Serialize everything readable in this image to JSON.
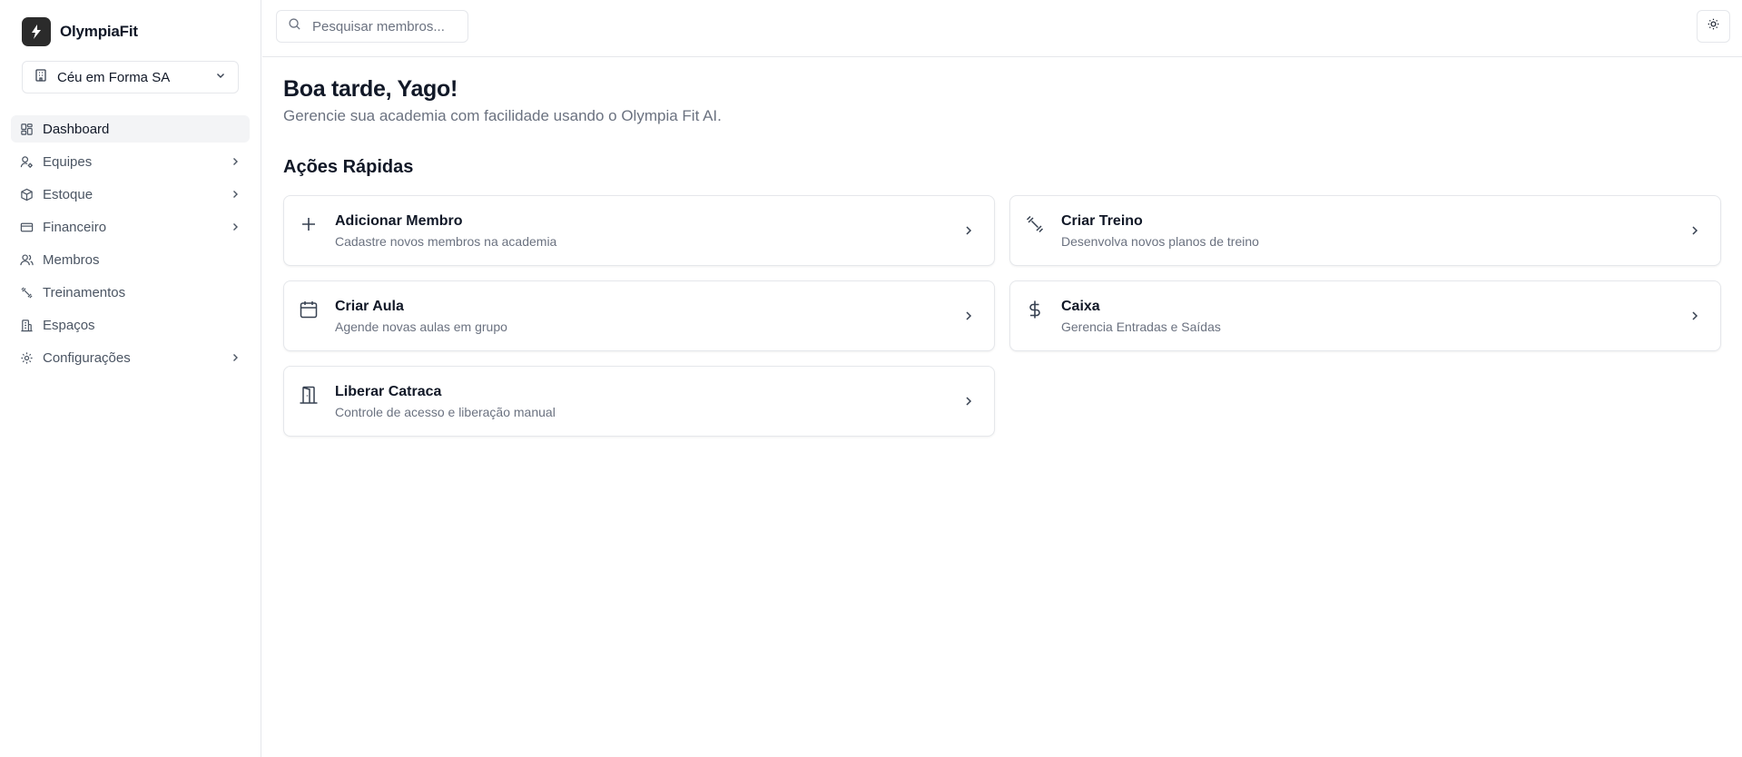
{
  "brand": {
    "name": "OlympiaFit"
  },
  "org_selector": {
    "value": "Céu em Forma SA"
  },
  "sidebar": {
    "items": [
      {
        "label": "Dashboard",
        "icon": "layout-grid-icon",
        "active": true,
        "expandable": false
      },
      {
        "label": "Equipes",
        "icon": "user-cog-icon",
        "active": false,
        "expandable": true
      },
      {
        "label": "Estoque",
        "icon": "package-icon",
        "active": false,
        "expandable": true
      },
      {
        "label": "Financeiro",
        "icon": "credit-card-icon",
        "active": false,
        "expandable": true
      },
      {
        "label": "Membros",
        "icon": "users-icon",
        "active": false,
        "expandable": false
      },
      {
        "label": "Treinamentos",
        "icon": "dumbbell-icon",
        "active": false,
        "expandable": false
      },
      {
        "label": "Espaços",
        "icon": "building-icon",
        "active": false,
        "expandable": false
      },
      {
        "label": "Configurações",
        "icon": "gear-icon",
        "active": false,
        "expandable": true
      }
    ]
  },
  "header": {
    "search": {
      "placeholder": "Pesquisar membros...",
      "value": ""
    },
    "theme_toggle_icon": "sun-icon"
  },
  "main": {
    "greeting": "Boa tarde, Yago!",
    "subtitle": "Gerencie sua academia com facilidade usando o Olympia Fit AI.",
    "quick_actions_title": "Ações Rápidas",
    "actions": [
      {
        "title": "Adicionar Membro",
        "description": "Cadastre novos membros na academia",
        "icon": "plus-icon"
      },
      {
        "title": "Criar Treino",
        "description": "Desenvolva novos planos de treino",
        "icon": "dumbbell-icon"
      },
      {
        "title": "Criar Aula",
        "description": "Agende novas aulas em grupo",
        "icon": "calendar-icon"
      },
      {
        "title": "Caixa",
        "description": "Gerencia Entradas e Saídas",
        "icon": "dollar-icon"
      },
      {
        "title": "Liberar Catraca",
        "description": "Controle de acesso e liberação manual",
        "icon": "door-open-icon"
      }
    ]
  },
  "colors": {
    "text_primary": "#111827",
    "text_muted": "#6b7280",
    "border": "#e5e7eb",
    "active_bg": "#f3f4f6",
    "brand_logo_bg": "#2b2b2b"
  }
}
